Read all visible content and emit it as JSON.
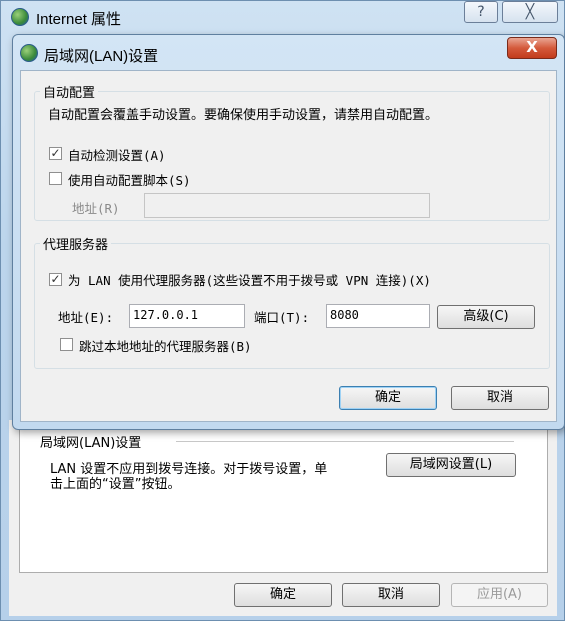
{
  "outer": {
    "title": "Internet 属性",
    "help_glyph": "?",
    "close_glyph": "╳",
    "lan_group_label": "局域网(LAN)设置",
    "lan_desc_line1": "LAN 设置不应用到拨号连接。对于拨号设置，单",
    "lan_desc_line2": "击上面的“设置”按钮。",
    "lan_button": "局域网设置(L)",
    "ok_label": "确定",
    "cancel_label": "取消",
    "apply_label": "应用(A)"
  },
  "dialog": {
    "title": "局域网(LAN)设置",
    "close_glyph": "X",
    "auto_config": {
      "label": "自动配置",
      "desc": "自动配置会覆盖手动设置。要确保使用手动设置，请禁用自动配置。",
      "auto_detect_label": "自动检测设置(A)",
      "auto_detect_checked": true,
      "use_script_label": "使用自动配置脚本(S)",
      "use_script_checked": false,
      "address_label": "地址(R)",
      "address_value": ""
    },
    "proxy": {
      "label": "代理服务器",
      "use_proxy_label": "为 LAN 使用代理服务器(这些设置不用于拨号或 VPN 连接)(X)",
      "use_proxy_checked": true,
      "address_label": "地址(E):",
      "address_value": "127.0.0.1",
      "port_label": "端口(T):",
      "port_value": "8080",
      "advanced_label": "高级(C)",
      "bypass_label": "跳过本地地址的代理服务器(B)",
      "bypass_checked": false
    },
    "ok_label": "确定",
    "cancel_label": "取消"
  },
  "colors": {
    "window_frame": "#bcd5ec",
    "close_button": "#c94a2c",
    "panel": "#f0f0f0"
  }
}
